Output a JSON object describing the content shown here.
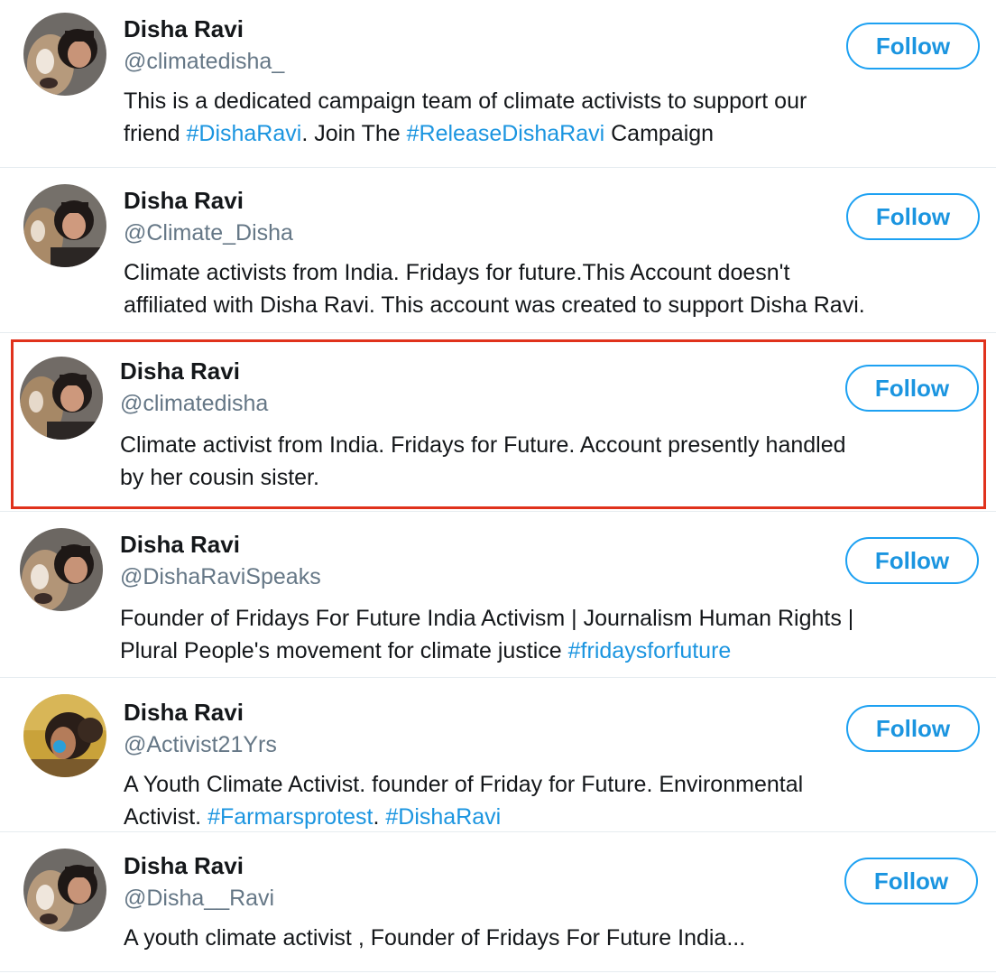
{
  "follow_label": "Follow",
  "colors": {
    "accent": "#1da1f2",
    "hashtag": "#1b95e0",
    "highlight": "#e0321c",
    "handle": "#657786"
  },
  "accounts": [
    {
      "name": "Disha Ravi",
      "handle": "@climatedisha_",
      "bio_line1": [
        "This is a dedicated campaign team of climate activists to support our"
      ],
      "bio_line2": [
        "friend ",
        "#DishaRavi",
        ". Join The ",
        "#ReleaseDishaRavi",
        " Campaign"
      ],
      "avatar": "woman-with-dog-photo"
    },
    {
      "name": "Disha Ravi",
      "handle": "@Climate_Disha",
      "bio_line1": [
        "Climate activists from India. Fridays for future.This Account doesn't"
      ],
      "bio_line2": [
        "affiliated with Disha Ravi. This account was created to support Disha Ravi."
      ],
      "avatar": "woman-with-dog-photo"
    },
    {
      "name": "Disha Ravi",
      "handle": "@climatedisha",
      "bio_line1": [
        "Climate activist from India. Fridays for Future. Account presently handled"
      ],
      "bio_line2": [
        "by her cousin sister."
      ],
      "avatar": "woman-with-dog-photo",
      "highlighted": true
    },
    {
      "name": "Disha Ravi",
      "handle": "@DishaRaviSpeaks",
      "bio_line1": [
        "Founder of Fridays For Future India Activism | Journalism Human Rights |"
      ],
      "bio_line2": [
        "Plural People's movement for climate justice ",
        "#fridaysforfuture"
      ],
      "avatar": "woman-with-dog-photo"
    },
    {
      "name": "Disha Ravi",
      "handle": "@Activist21Yrs",
      "bio_line1": [
        "A Youth Climate Activist. founder of Friday for Future. Environmental"
      ],
      "bio_line2": [
        "Activist. ",
        "#Farmarsprotest",
        ". ",
        "#DishaRavi"
      ],
      "avatar": "woman-with-face-paint-photo"
    },
    {
      "name": "Disha Ravi",
      "handle": "@Disha__Ravi",
      "bio_line1": [
        "A youth climate activist , Founder of Fridays For Future India..."
      ],
      "bio_line2": [],
      "avatar": "woman-with-dog-photo"
    }
  ]
}
